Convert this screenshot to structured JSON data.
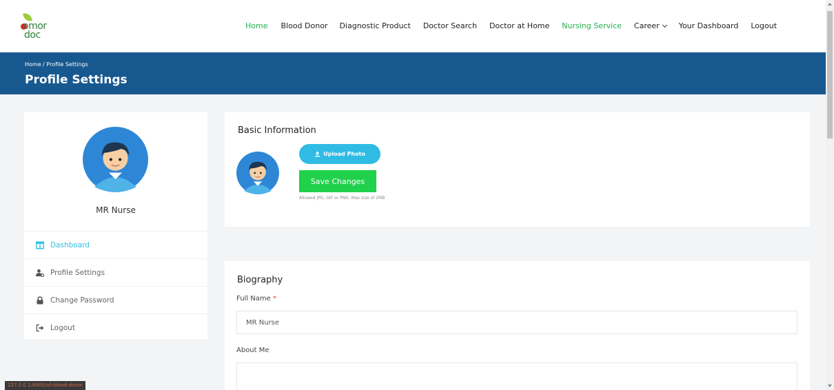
{
  "logo": {
    "line1": "omor",
    "line2": "doc",
    "text_color": "#2f7d38"
  },
  "nav": {
    "items": [
      {
        "label": "Home",
        "green": true
      },
      {
        "label": "Blood Donor",
        "green": false
      },
      {
        "label": "Diagnostic Product",
        "green": false
      },
      {
        "label": "Doctor Search",
        "green": false
      },
      {
        "label": "Doctor at Home",
        "green": false
      },
      {
        "label": "Nursing Service",
        "green": true
      },
      {
        "label": "Career",
        "green": false
      },
      {
        "label": "Your Dashboard",
        "green": false
      },
      {
        "label": "Logout",
        "green": false
      }
    ]
  },
  "header": {
    "breadcrumb": "Home / Profile Settings",
    "title": "Profile Settings",
    "background": "#17598f"
  },
  "profile": {
    "name": "MR Nurse"
  },
  "sidebar": {
    "items": [
      {
        "label": "Dashboard",
        "icon": "columns-icon",
        "active": true
      },
      {
        "label": "Profile Settings",
        "icon": "user-cog-icon",
        "active": false
      },
      {
        "label": "Change Password",
        "icon": "lock-icon",
        "active": false
      },
      {
        "label": "Logout",
        "icon": "sign-out-icon",
        "active": false
      }
    ]
  },
  "basic_info": {
    "title": "Basic Information",
    "upload_label": "Upload Photo",
    "save_label": "Save Changes",
    "hint": "Allowed JPG, GIF or PNG. Max size of 2MB"
  },
  "biography": {
    "title": "Biography",
    "full_name_label": "Full Name",
    "required_mark": "*",
    "full_name_value": "MR Nurse",
    "about_label": "About Me",
    "about_value": ""
  },
  "status_bar": {
    "url": "127.0.0.1:8000/all-blood-donor"
  },
  "colors": {
    "accent": "#2fbbe4",
    "save": "#20d14c",
    "nav_active": "#21b04b"
  }
}
